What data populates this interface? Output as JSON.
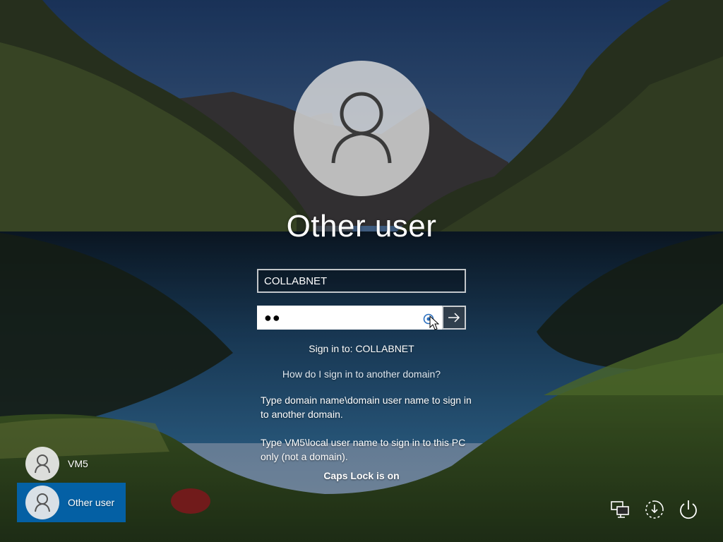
{
  "user": {
    "display_name": "Other user",
    "username_value": "COLLABNET",
    "password_mask": "●●"
  },
  "signin": {
    "domain_text": "Sign in to: COLLABNET",
    "help_link": "How do I sign in to another domain?",
    "help_line1": "Type domain name\\domain user name to sign in to another domain.",
    "help_line2": "Type VM5\\local user name to sign in to this PC only (not a domain).",
    "caps_lock": "Caps Lock is on"
  },
  "user_list": [
    {
      "label": "VM5",
      "selected": false
    },
    {
      "label": "Other user",
      "selected": true
    }
  ],
  "icons": {
    "avatar": "person-icon",
    "reveal": "eye-icon",
    "submit": "arrow-right-icon",
    "network": "network-icon",
    "ease": "ease-of-access-icon",
    "power": "power-icon"
  },
  "colors": {
    "accent": "#0067b8"
  }
}
